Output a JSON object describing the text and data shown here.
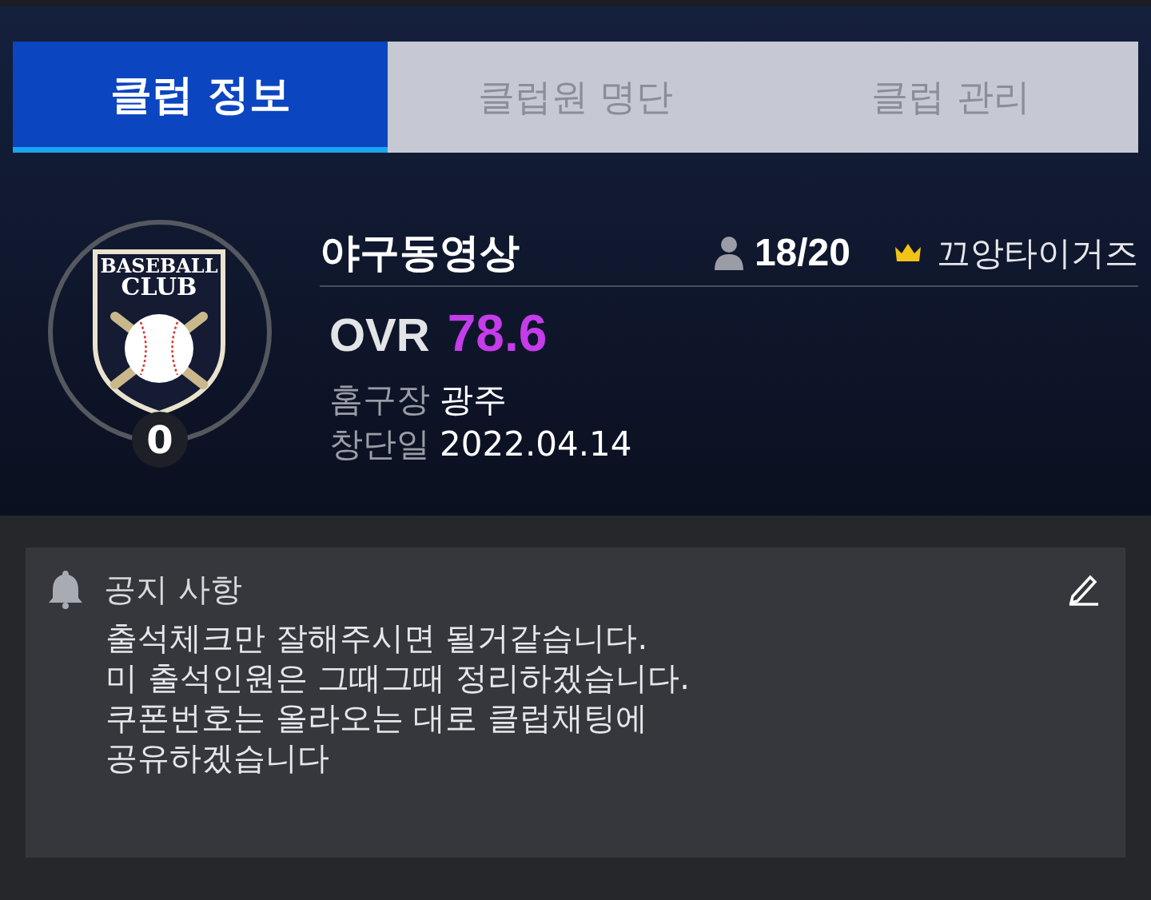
{
  "tabs": [
    {
      "label": "클럽 정보",
      "selected": true
    },
    {
      "label": "클럽원 명단",
      "selected": false
    },
    {
      "label": "클럽 관리",
      "selected": false
    }
  ],
  "club": {
    "emblem_lines": [
      "BASEBALL",
      "CLUB"
    ],
    "level": "0",
    "name": "야구동영상",
    "members": "18/20",
    "leader": "끄앙타이거즈",
    "ovr_label": "OVR",
    "ovr": "78.6",
    "details": [
      {
        "label": "홈구장",
        "value": "광주"
      },
      {
        "label": "창단일",
        "value": "2022.04.14"
      }
    ]
  },
  "notice": {
    "title": "공지 사항",
    "lines": [
      "출석체크만 잘해주시면 될거같습니다.",
      "미 출석인원은 그때그때 정리하겠습니다.",
      "쿠폰번호는 올라오는 대로 클럽채팅에",
      "공유하겠습니다"
    ]
  }
}
